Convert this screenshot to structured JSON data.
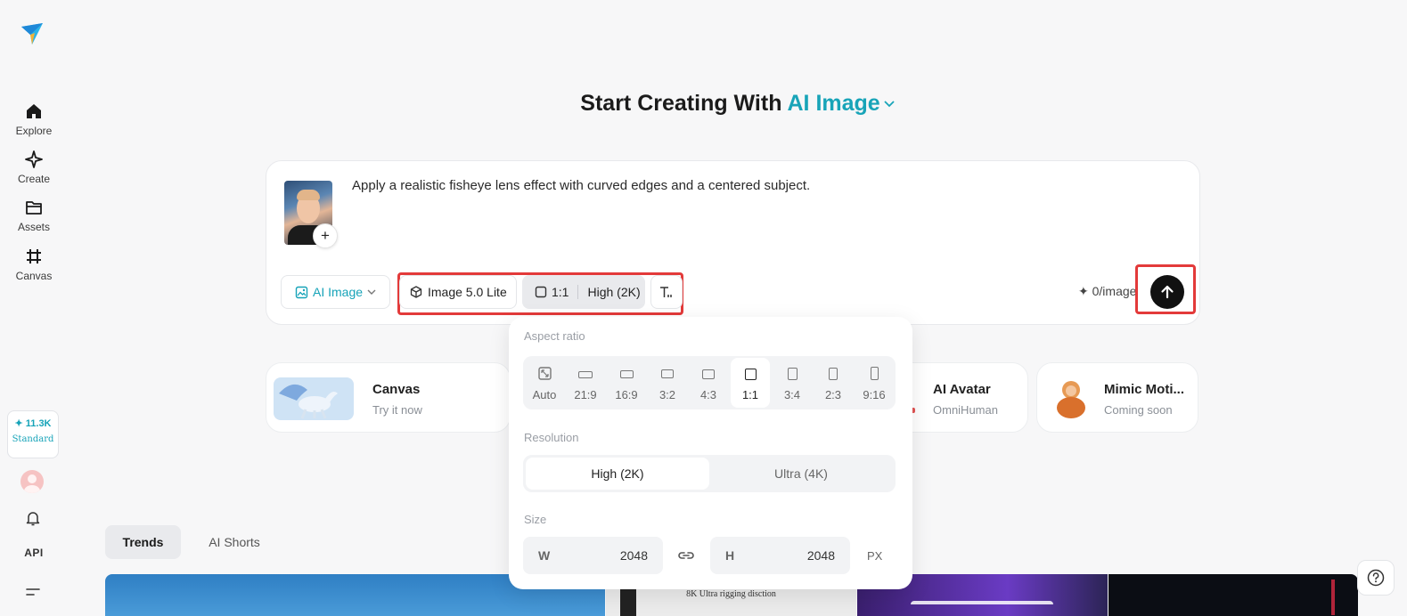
{
  "sidebar": {
    "items": [
      {
        "label": "Explore",
        "icon": "home-icon"
      },
      {
        "label": "Create",
        "icon": "sparkle-icon"
      },
      {
        "label": "Assets",
        "icon": "folder-icon"
      },
      {
        "label": "Canvas",
        "icon": "canvas-icon"
      }
    ],
    "credits": {
      "amount": "✦ 11.3K",
      "tier": "Standard"
    },
    "api_label": "API"
  },
  "header": {
    "title_prefix": "Start Creating With ",
    "title_accent": "AI Image"
  },
  "prompt": {
    "text": "Apply a realistic fisheye lens effect with curved edges and a centered subject.",
    "add_label": "+"
  },
  "toolbar": {
    "mode_label": "AI Image",
    "model_label": "Image 5.0 Lite",
    "ratio_label": "1:1",
    "quality_label": "High (2K)",
    "cost_label": "✦ 0/image"
  },
  "features": [
    {
      "name": "Canvas",
      "sub": "Try it now"
    },
    {
      "name": "AI Avatar",
      "sub": "OmniHuman"
    },
    {
      "name": "Mimic Moti...",
      "sub": "Coming soon"
    }
  ],
  "tabs": [
    {
      "label": "Trends",
      "active": true
    },
    {
      "label": "AI Shorts",
      "active": false
    }
  ],
  "gallery": {
    "caption": "8K Ultra rigging disction"
  },
  "popover": {
    "aspect_label": "Aspect ratio",
    "ratios": [
      "Auto",
      "21:9",
      "16:9",
      "3:2",
      "4:3",
      "1:1",
      "3:4",
      "2:3",
      "9:16"
    ],
    "selected_ratio": "1:1",
    "resolution_label": "Resolution",
    "resolutions": [
      "High (2K)",
      "Ultra (4K)"
    ],
    "selected_resolution": "High (2K)",
    "size_label": "Size",
    "width_key": "W",
    "width_value": "2048",
    "height_key": "H",
    "height_value": "2048",
    "unit": "PX"
  },
  "colors": {
    "accent": "#18a4b8",
    "highlight": "#e33a3a"
  }
}
